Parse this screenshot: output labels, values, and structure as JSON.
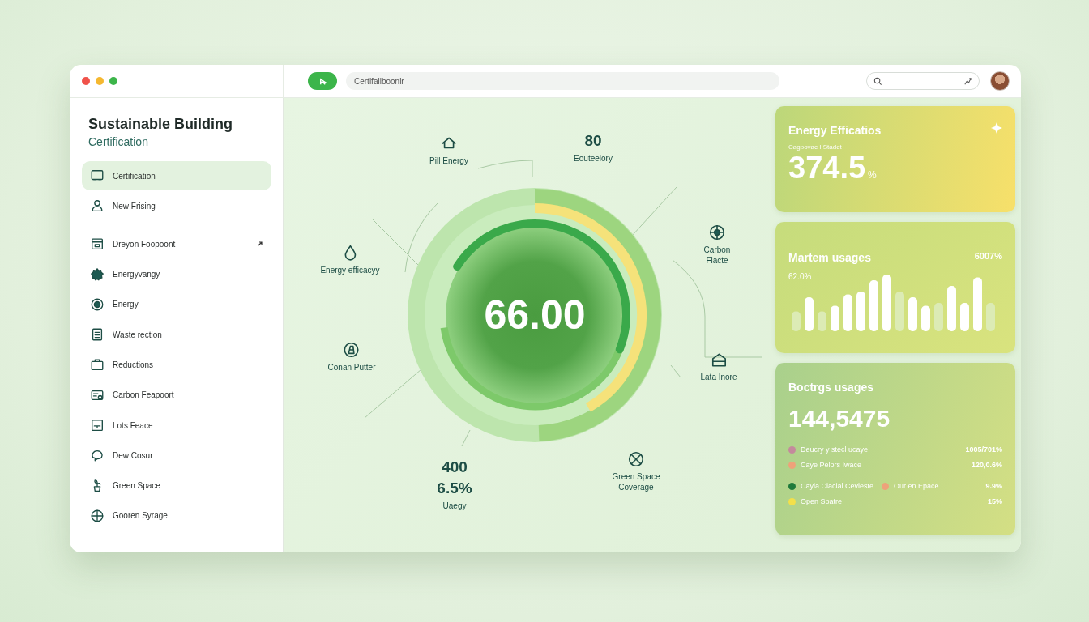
{
  "window": {
    "controls": [
      {
        "color": "#f0524a"
      },
      {
        "color": "#f5b830"
      },
      {
        "color": "#3cb54a"
      }
    ]
  },
  "toolbar": {
    "address": "Certifailboonlr"
  },
  "sidebar": {
    "title": "Sustainable Building",
    "subtitle": "Certification",
    "sections": [
      {
        "items": [
          {
            "label": "Certification",
            "selected": true,
            "expandable": false
          },
          {
            "label": "New Frising",
            "selected": false,
            "expandable": false
          }
        ]
      },
      {
        "items": [
          {
            "label": "Dreyon Foopoont",
            "selected": false,
            "expandable": true
          },
          {
            "label": "Energyvangy",
            "selected": false,
            "expandable": false
          },
          {
            "label": "Energy",
            "selected": false,
            "expandable": false
          },
          {
            "label": "Waste rection",
            "selected": false,
            "expandable": false
          },
          {
            "label": "Reductions",
            "selected": false,
            "expandable": false
          },
          {
            "label": "Carbon Feapoort",
            "selected": false,
            "expandable": false
          },
          {
            "label": "Lots Feace",
            "selected": false,
            "expandable": false
          },
          {
            "label": "Dew Cosur",
            "selected": false,
            "expandable": false
          },
          {
            "label": "Green Space",
            "selected": false,
            "expandable": false
          },
          {
            "label": "Gooren Syrage",
            "selected": false,
            "expandable": false
          }
        ]
      }
    ]
  },
  "gauge": {
    "value": "66.00",
    "labels": [
      {
        "caption": "Pill Energy"
      },
      {
        "values": [
          "80"
        ],
        "caption": "Eouteeiory"
      },
      {
        "caption": "Energy efficacyy"
      },
      {
        "caption": "Carbon Fiacte"
      },
      {
        "caption": "Conan Putter"
      },
      {
        "caption": "Lata Inore"
      },
      {
        "values": [
          "400",
          "6.5%"
        ],
        "caption": "Uaegy"
      },
      {
        "caption": "Green Space Coverage"
      }
    ]
  },
  "cards": [
    {
      "kind": "stat",
      "title": "Energy Efficatios",
      "subtitle": "Cagpovac I Stadet",
      "value": "374.5",
      "unit": "%"
    },
    {
      "kind": "bars",
      "title": "Martem usages",
      "value": "6007%",
      "subvalue": "62.0%"
    },
    {
      "kind": "legend",
      "title": "Boctrgs usages",
      "value": "144,5475",
      "rows": [
        {
          "items": [
            {
              "label": "Deucry y stecl ucaye",
              "color": "#c48a9c"
            }
          ],
          "value": "1005/701%"
        },
        {
          "items": [
            {
              "label": "Caye Pelors Iwace",
              "color": "#eea27a"
            }
          ],
          "value": "120,0.6%"
        },
        {
          "items": [
            {
              "label": "Cayia Ciacial Cevieste",
              "color": "#1e7a3a"
            },
            {
              "label": "Our en Epace",
              "color": "#eea27a"
            }
          ],
          "value": "9.9%"
        },
        {
          "items": [
            {
              "label": "Open Spatre",
              "color": "#f3e04a"
            }
          ],
          "value": "15%"
        }
      ]
    }
  ]
}
